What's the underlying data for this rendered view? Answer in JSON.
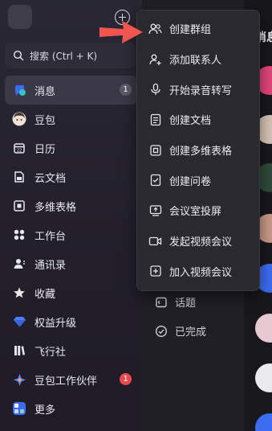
{
  "search": {
    "label": "搜索 (Ctrl + K)"
  },
  "nav": [
    {
      "label": "消息",
      "icon": "message-icon",
      "badge": "1"
    },
    {
      "label": "豆包",
      "icon": "doubao-avatar-icon"
    },
    {
      "label": "日历",
      "icon": "calendar-icon"
    },
    {
      "label": "云文档",
      "icon": "cloud-doc-icon"
    },
    {
      "label": "多维表格",
      "icon": "multi-table-icon"
    },
    {
      "label": "工作台",
      "icon": "workspace-icon"
    },
    {
      "label": "通讯录",
      "icon": "contacts-icon"
    },
    {
      "label": "收藏",
      "icon": "star-icon"
    },
    {
      "label": "权益升级",
      "icon": "diamond-icon"
    },
    {
      "label": "飞行社",
      "icon": "book-icon"
    },
    {
      "label": "豆包工作伙伴",
      "icon": "partner-icon",
      "badge": "1"
    },
    {
      "label": "更多",
      "icon": "more-icon"
    }
  ],
  "middle": {
    "topics": "话题",
    "done": "已完成"
  },
  "right": {
    "title": "消息"
  },
  "menu": [
    {
      "label": "创建群组",
      "icon": "group-icon"
    },
    {
      "label": "添加联系人",
      "icon": "add-contact-icon"
    },
    {
      "label": "开始录音转写",
      "icon": "microphone-icon"
    },
    {
      "label": "创建文档",
      "icon": "document-icon"
    },
    {
      "label": "创建多维表格",
      "icon": "multi-table-icon"
    },
    {
      "label": "创建问卷",
      "icon": "survey-icon"
    },
    {
      "label": "会议室投屏",
      "icon": "screen-cast-icon"
    },
    {
      "label": "发起视频会议",
      "icon": "video-icon"
    },
    {
      "label": "加入视频会议",
      "icon": "join-meeting-icon"
    }
  ],
  "colors": {
    "accent": "#3c6cf0",
    "badge_red": "#e9494f",
    "arrow": "#f0554f"
  }
}
